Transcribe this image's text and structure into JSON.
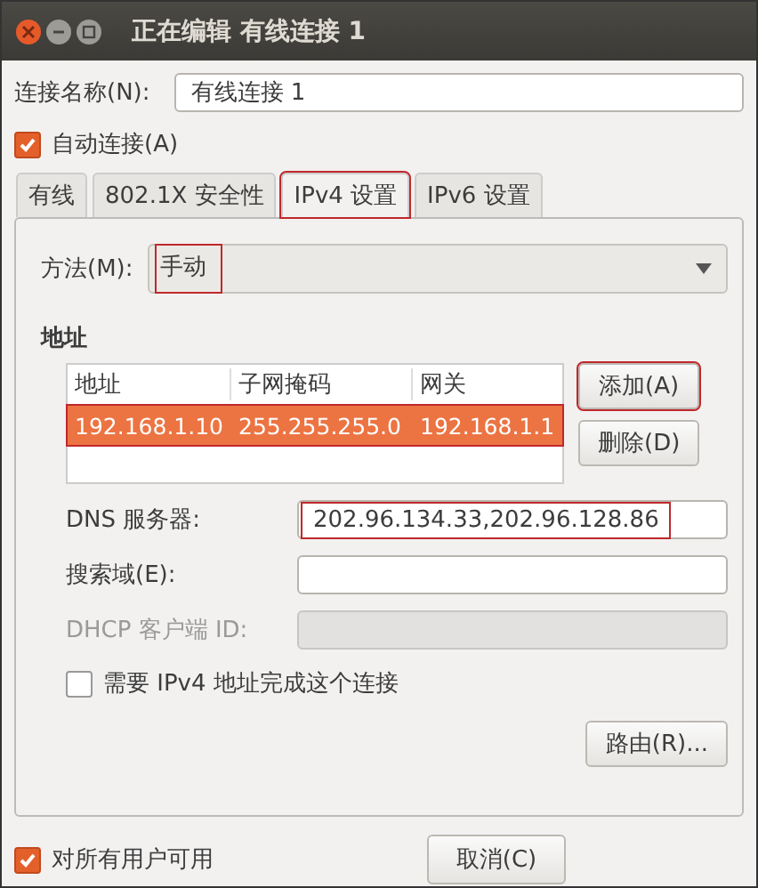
{
  "window": {
    "title": "正在编辑 有线连接 1"
  },
  "connection_name": {
    "label": "连接名称(N):",
    "value": "有线连接 1"
  },
  "auto_connect": {
    "label": "自动连接(A)",
    "checked": true
  },
  "tabs": [
    {
      "label": "有线",
      "selected": false,
      "highlighted": false
    },
    {
      "label": "802.1X 安全性",
      "selected": false,
      "highlighted": false
    },
    {
      "label": "IPv4 设置",
      "selected": true,
      "highlighted": true
    },
    {
      "label": "IPv6 设置",
      "selected": false,
      "highlighted": false
    }
  ],
  "method": {
    "label": "方法(M):",
    "value": "手动",
    "highlighted": true
  },
  "addresses": {
    "heading": "地址",
    "columns": [
      "地址",
      "子网掩码",
      "网关"
    ],
    "rows": [
      {
        "cells": [
          "192.168.1.10",
          "255.255.255.0",
          "192.168.1.1"
        ],
        "selected": true,
        "highlighted": true
      }
    ],
    "buttons": [
      {
        "label": "添加(A)",
        "highlighted": true
      },
      {
        "label": "删除(D)",
        "highlighted": false
      }
    ]
  },
  "fields": [
    {
      "label": "DNS 服务器:",
      "value": "202.96.134.33,202.96.128.86",
      "disabled": false,
      "highlighted": true
    },
    {
      "label": "搜索域(E):",
      "disabled": false,
      "highlighted": false
    },
    {
      "label": "DHCP 客户端 ID:",
      "disabled": true,
      "highlighted": false
    }
  ],
  "require_ipv4": {
    "label": "需要 IPv4 地址完成这个连接",
    "checked": false
  },
  "routes_button": "路由(R)...",
  "all_users": {
    "label": "对所有用户可用",
    "checked": true
  },
  "cancel_button": "取消(C)"
}
